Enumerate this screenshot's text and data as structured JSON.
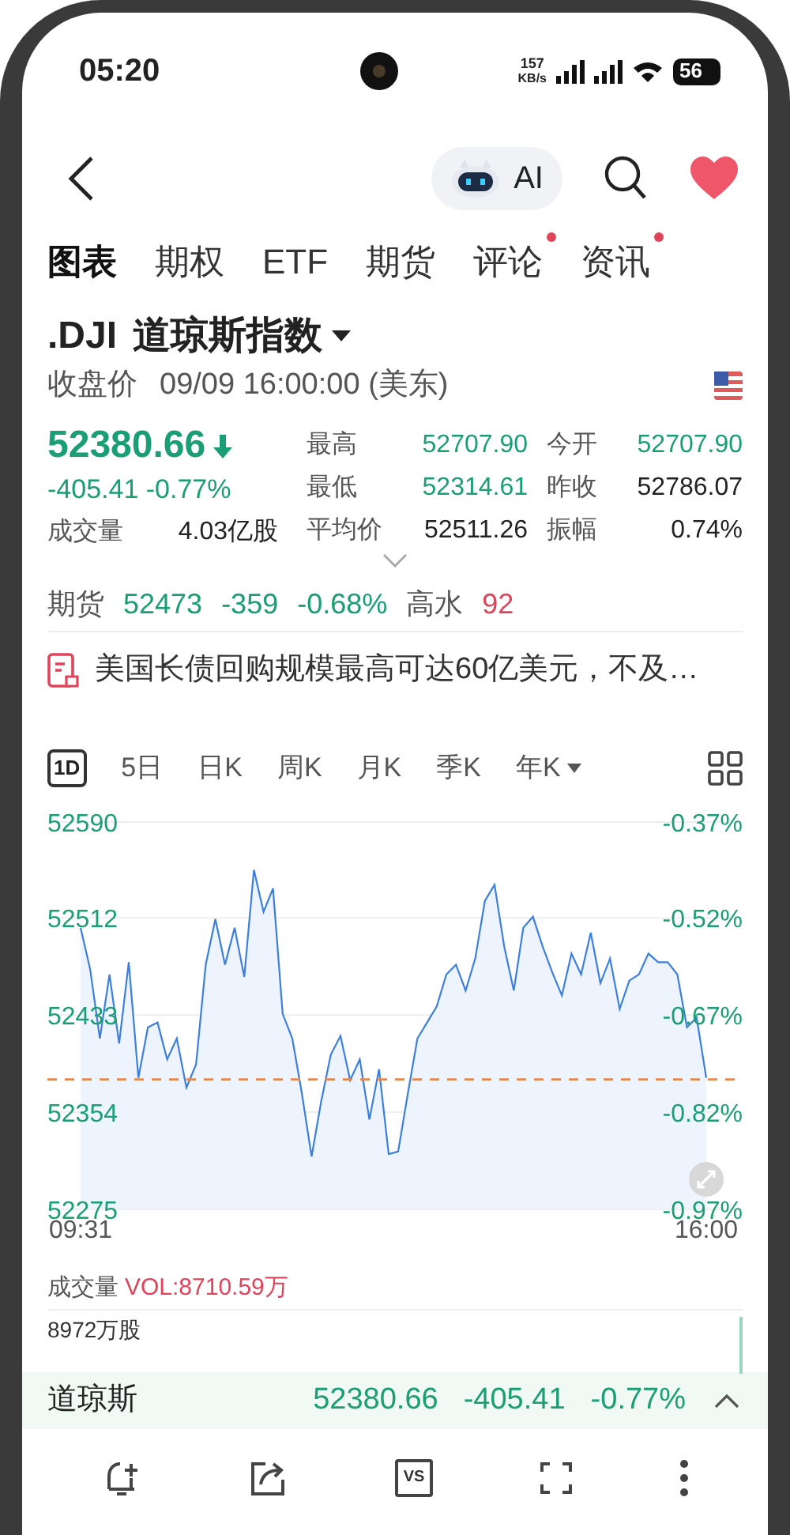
{
  "status_bar": {
    "time": "05:20",
    "speed": "157",
    "speed_unit": "KB/s",
    "battery": "56"
  },
  "nav": {
    "ai_label": "AI"
  },
  "tabs": [
    {
      "label": "图表",
      "selected": true,
      "badge": false
    },
    {
      "label": "期权",
      "selected": false,
      "badge": false
    },
    {
      "label": "ETF",
      "selected": false,
      "badge": false
    },
    {
      "label": "期货",
      "selected": false,
      "badge": false
    },
    {
      "label": "评论",
      "selected": false,
      "badge": true
    },
    {
      "label": "资讯",
      "selected": false,
      "badge": true
    }
  ],
  "instrument": {
    "symbol": ".DJI",
    "name": "道琼斯指数",
    "status": "收盘价",
    "datetime": "09/09 16:00:00 (美东)"
  },
  "quote": {
    "price": "52380.66",
    "falling": true,
    "change": "-405.41 -0.77%",
    "volume_label": "成交量",
    "volume_value": "4.03亿股",
    "stats": [
      {
        "label": "最高",
        "value": "52707.90",
        "color": "#1a9e74"
      },
      {
        "label": "今开",
        "value": "52707.90",
        "color": "#1a9e74"
      },
      {
        "label": "最低",
        "value": "52314.61",
        "color": "#1a9e74"
      },
      {
        "label": "昨收",
        "value": "52786.07",
        "color": "#222222"
      },
      {
        "label": "平均价",
        "value": "52511.26",
        "color": "#222222"
      },
      {
        "label": "振幅",
        "value": "0.74%",
        "color": "#222222"
      }
    ]
  },
  "futures": [
    {
      "text": "期货",
      "color": "#555555"
    },
    {
      "text": "52473",
      "color": "#1a9e74"
    },
    {
      "text": "-359",
      "color": "#1a9e74"
    },
    {
      "text": "-0.68%",
      "color": "#1a9e74"
    },
    {
      "text": "高水",
      "color": "#555555"
    },
    {
      "text": "92",
      "color": "#e0445a"
    }
  ],
  "news": {
    "headline": "美国长债回购规模最高可达60亿美元，不及…"
  },
  "periods": [
    {
      "label": "1D",
      "selected": true,
      "dropdown": false
    },
    {
      "label": "5日",
      "selected": false,
      "dropdown": false
    },
    {
      "label": "日K",
      "selected": false,
      "dropdown": false
    },
    {
      "label": "周K",
      "selected": false,
      "dropdown": false
    },
    {
      "label": "月K",
      "selected": false,
      "dropdown": false
    },
    {
      "label": "季K",
      "selected": false,
      "dropdown": false
    },
    {
      "label": "年K",
      "selected": false,
      "dropdown": true
    }
  ],
  "chart": {
    "chart_data": {
      "type": "area",
      "categories": [
        "09:31",
        null,
        null,
        null,
        null,
        null,
        null,
        null,
        null,
        null,
        null,
        null,
        null,
        null,
        null,
        null,
        null,
        null,
        null,
        null,
        null,
        null,
        null,
        null,
        null,
        null,
        null,
        null,
        null,
        null,
        null,
        null,
        null,
        null,
        null,
        null,
        null,
        null,
        null,
        null,
        null,
        null,
        null,
        null,
        null,
        null,
        null,
        null,
        null,
        null,
        null,
        null,
        null,
        null,
        null,
        null,
        null,
        null,
        null,
        null,
        null,
        null,
        null,
        null,
        null,
        "16:00"
      ],
      "values": [
        52504,
        52470,
        52414,
        52466,
        52410,
        52476,
        52382,
        52423,
        52427,
        52397,
        52414,
        52374,
        52393,
        52474,
        52511,
        52474,
        52504,
        52464,
        52551,
        52517,
        52536,
        52434,
        52414,
        52369,
        52318,
        52363,
        52401,
        52416,
        52380,
        52397,
        52348,
        52389,
        52320,
        52322,
        52369,
        52414,
        52427,
        52440,
        52466,
        52474,
        52453,
        52479,
        52526,
        52539,
        52489,
        52453,
        52504,
        52513,
        52489,
        52468,
        52449,
        52483,
        52466,
        52500,
        52459,
        52479,
        52438,
        52461,
        52466,
        52483,
        52476,
        52476,
        52466,
        52423,
        52431,
        52382
      ],
      "ylim": [
        52275,
        52590
      ],
      "yticks": [
        52590,
        52512,
        52433,
        52354,
        52275
      ],
      "grid": true,
      "ref_lines": [
        {
          "axis": "y",
          "value": 52380.66
        }
      ]
    },
    "right_axis": [
      "-0.37%",
      "-0.52%",
      "-0.67%",
      "-0.82%",
      "-0.97%"
    ]
  },
  "volume": {
    "label": "成交量",
    "indicator": "VOL:8710.59万",
    "scale": "8972万股"
  },
  "ticker": {
    "name": "道琼斯",
    "price": "52380.66",
    "change": "-405.41",
    "percent": "-0.77%"
  },
  "toolbar": {
    "compare_label": "VS"
  }
}
